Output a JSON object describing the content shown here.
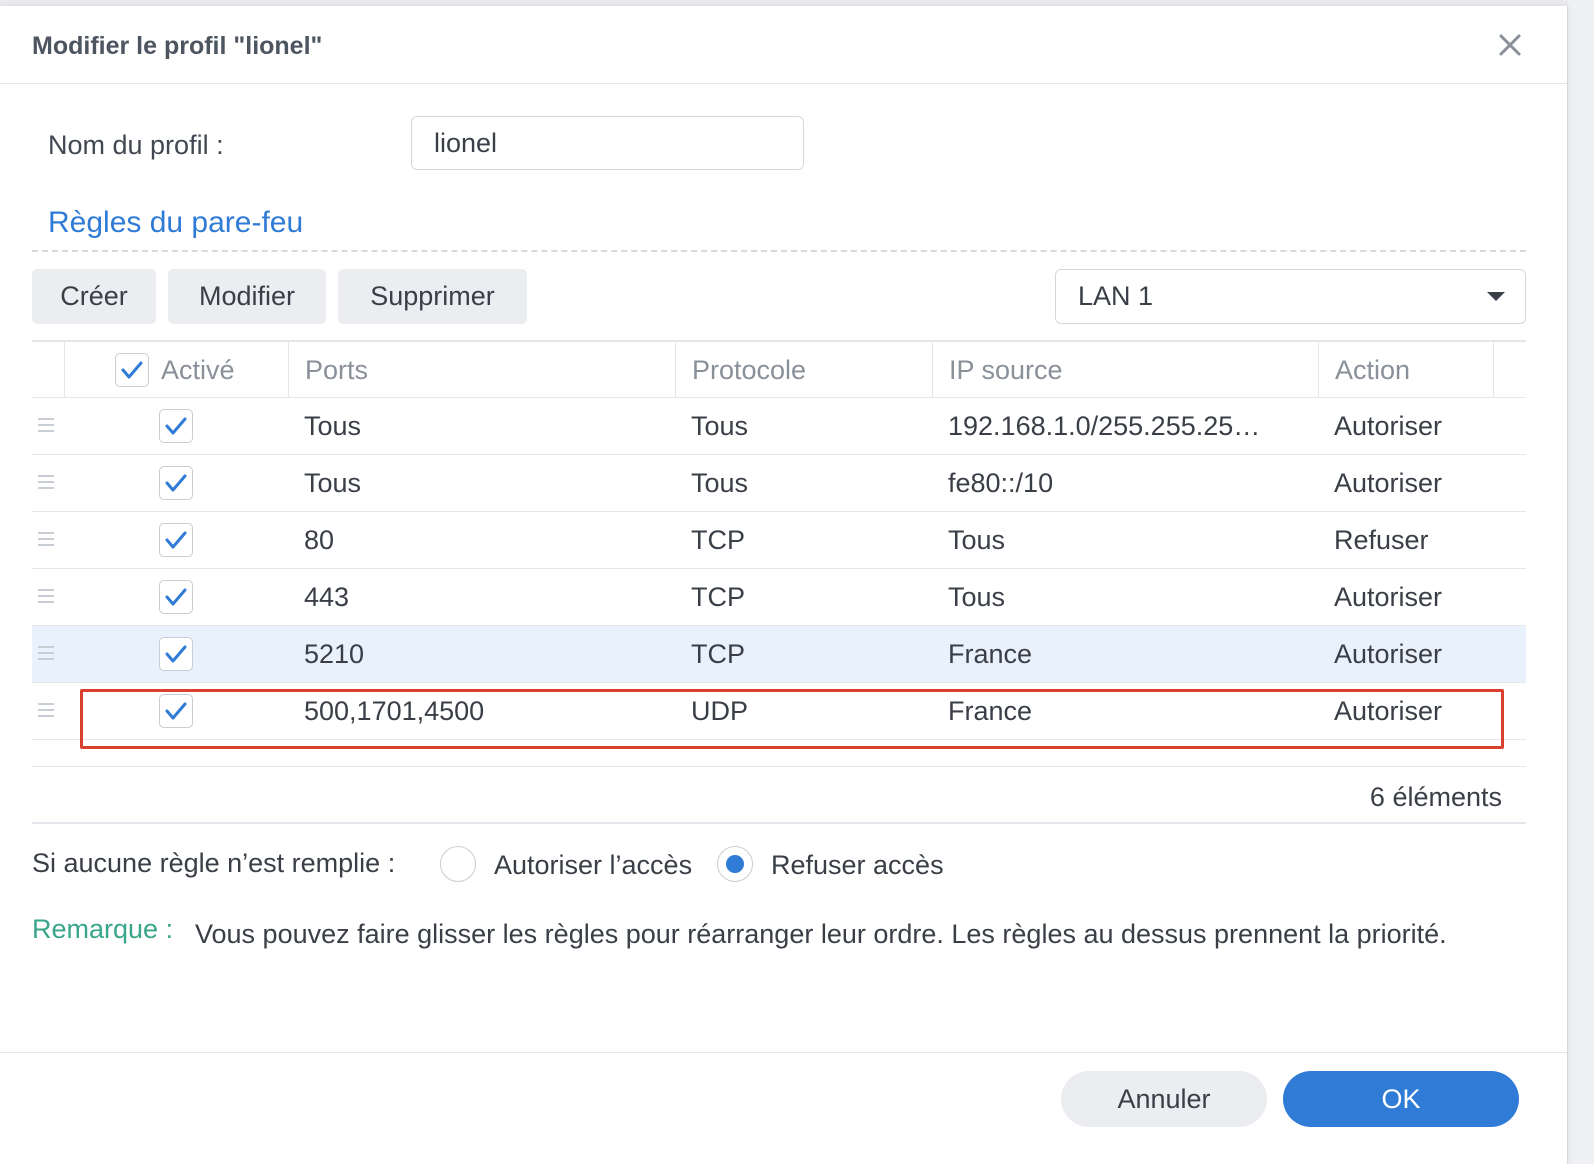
{
  "dialog": {
    "title": "Modifier le profil \"lionel\"",
    "close_icon": "close-icon"
  },
  "profile": {
    "label": "Nom du profil :",
    "value": "lionel"
  },
  "section": {
    "title": "Règles du pare-feu"
  },
  "toolbar": {
    "create_label": "Créer",
    "modify_label": "Modifier",
    "delete_label": "Supprimer",
    "interface_selected": "LAN 1"
  },
  "table": {
    "headers": {
      "enabled": "Activé",
      "ports": "Ports",
      "protocol": "Protocole",
      "source_ip": "IP source",
      "action": "Action"
    },
    "rows": [
      {
        "enabled": true,
        "ports": "Tous",
        "protocol": "Tous",
        "source_ip": "192.168.1.0/255.255.25…",
        "action": "Autoriser"
      },
      {
        "enabled": true,
        "ports": "Tous",
        "protocol": "Tous",
        "source_ip": "fe80::/10",
        "action": "Autoriser"
      },
      {
        "enabled": true,
        "ports": "80",
        "protocol": "TCP",
        "source_ip": "Tous",
        "action": "Refuser"
      },
      {
        "enabled": true,
        "ports": "443",
        "protocol": "TCP",
        "source_ip": "Tous",
        "action": "Autoriser"
      },
      {
        "enabled": true,
        "ports": "5210",
        "protocol": "TCP",
        "source_ip": "France",
        "action": "Autoriser"
      },
      {
        "enabled": true,
        "ports": "500,1701,4500",
        "protocol": "UDP",
        "source_ip": "France",
        "action": "Autoriser"
      }
    ],
    "selected_row_index": 4,
    "highlighted_row_index": 5,
    "count_label": "6 éléments"
  },
  "no_rule": {
    "label": "Si aucune règle n’est remplie :",
    "allow_label": "Autoriser l’accès",
    "deny_label": "Refuser accès",
    "selected": "deny"
  },
  "note": {
    "label": "Remarque :",
    "text": "Vous pouvez faire glisser les règles pour réarranger leur ordre. Les règles au dessus prennent la priorité."
  },
  "footer": {
    "cancel_label": "Annuler",
    "ok_label": "OK"
  },
  "colors": {
    "accent": "#2f7bd6",
    "highlight_border": "#d9412e",
    "note_label": "#3aa58a",
    "selected_row": "#e9f2fc"
  }
}
